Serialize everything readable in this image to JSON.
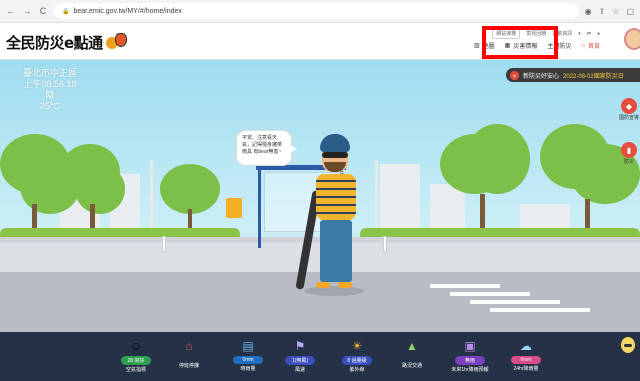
{
  "browser": {
    "url": "bear.emic.gov.tw/MY/#/home/index",
    "back": "←",
    "forward": "→",
    "reload": "C"
  },
  "header": {
    "logo": "全民防災e點通",
    "top_links": [
      "網站導覽",
      "意見回饋",
      "運動資訊"
    ],
    "nav": {
      "map": "地圖",
      "disaster": "災害情報",
      "theme": "主題防災",
      "home": "首頁"
    }
  },
  "weather": {
    "location": "臺北市中正區",
    "time": "上午08:56:19",
    "condition": "陰",
    "temperature": "25°C"
  },
  "ticker": {
    "label": "新防災好安心",
    "date": "2022-08-02國家防災日"
  },
  "side": [
    {
      "label": "國防宣導"
    },
    {
      "label": "防災"
    }
  ],
  "bubble": "平安、注意看天氣，記得隨身攜帶雨具 有bear無患~",
  "bottom": [
    {
      "icon": "air-quality-icon",
      "value": "28 良好",
      "label": "空氣指標",
      "color": "#2e9e4f"
    },
    {
      "icon": "school-icon",
      "value": "",
      "label": "停班停課",
      "color": "#d94a4a"
    },
    {
      "icon": "rain-gauge-icon",
      "value": "0mm",
      "label": "時雨量",
      "color": "#1f6fbf"
    },
    {
      "icon": "wind-icon",
      "value": "1(無風)",
      "label": "風速",
      "color": "#3a4fbf"
    },
    {
      "icon": "uv-icon",
      "value": "8 過量級",
      "label": "紫外線",
      "color": "#3a4fbf"
    },
    {
      "icon": "traffic-icon",
      "value": "",
      "label": "路況交通",
      "color": "#2b3a55"
    },
    {
      "icon": "forecast-icon",
      "value": "無雨",
      "label": "未來1hr降雨預報",
      "color": "#7b3fbf"
    },
    {
      "icon": "rain24-icon",
      "value": "0mm",
      "label": "24hr降雨量",
      "color": "#d94a8a"
    }
  ]
}
